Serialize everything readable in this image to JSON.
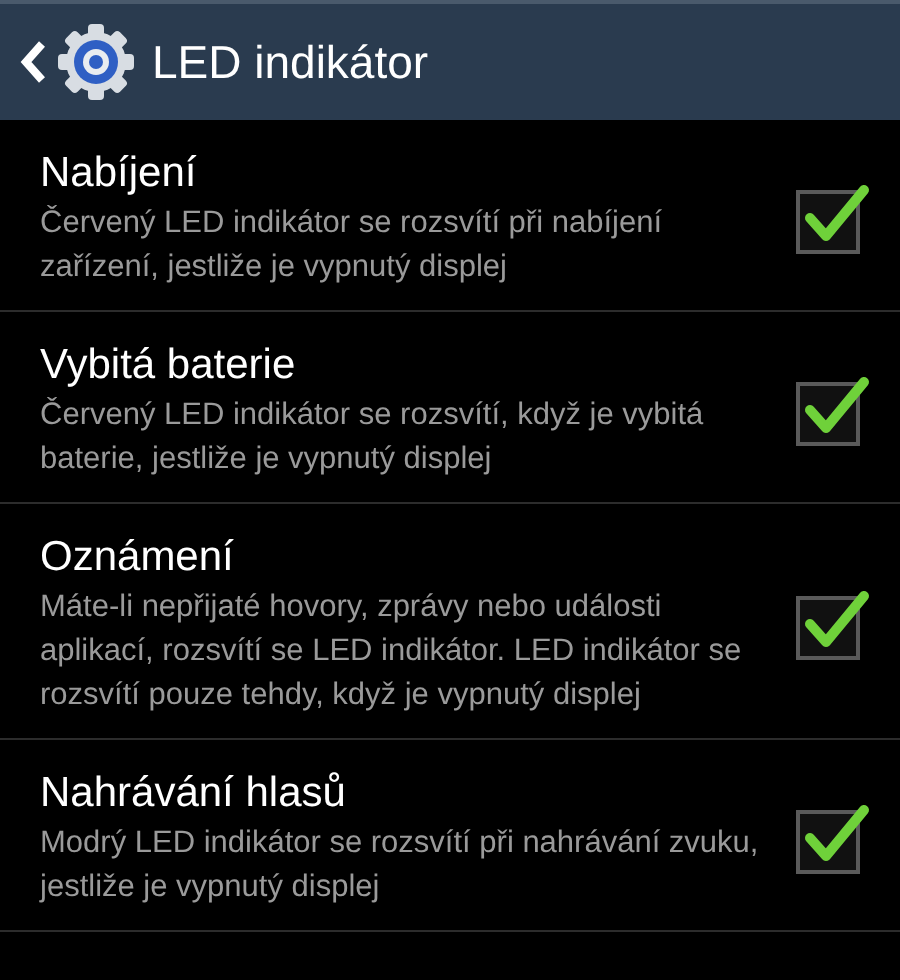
{
  "header": {
    "title": "LED indikátor"
  },
  "items": [
    {
      "title": "Nabíjení",
      "description": "Červený LED indikátor se rozsvítí při nabíjení zařízení, jestliže je vypnutý displej",
      "checked": true
    },
    {
      "title": "Vybitá baterie",
      "description": "Červený LED indikátor se rozsvítí, když je vybitá baterie, jestliže je vypnutý displej",
      "checked": true
    },
    {
      "title": "Oznámení",
      "description": "Máte-li nepřijaté hovory, zprávy nebo události aplikací, rozsvítí se LED indikátor. LED indikátor se rozsvítí pouze tehdy, když je vypnutý displej",
      "checked": true
    },
    {
      "title": "Nahrávání hlasů",
      "description": "Modrý LED indikátor se rozsvítí při nahrávání zvuku, jestliže je vypnutý displej",
      "checked": true
    }
  ]
}
